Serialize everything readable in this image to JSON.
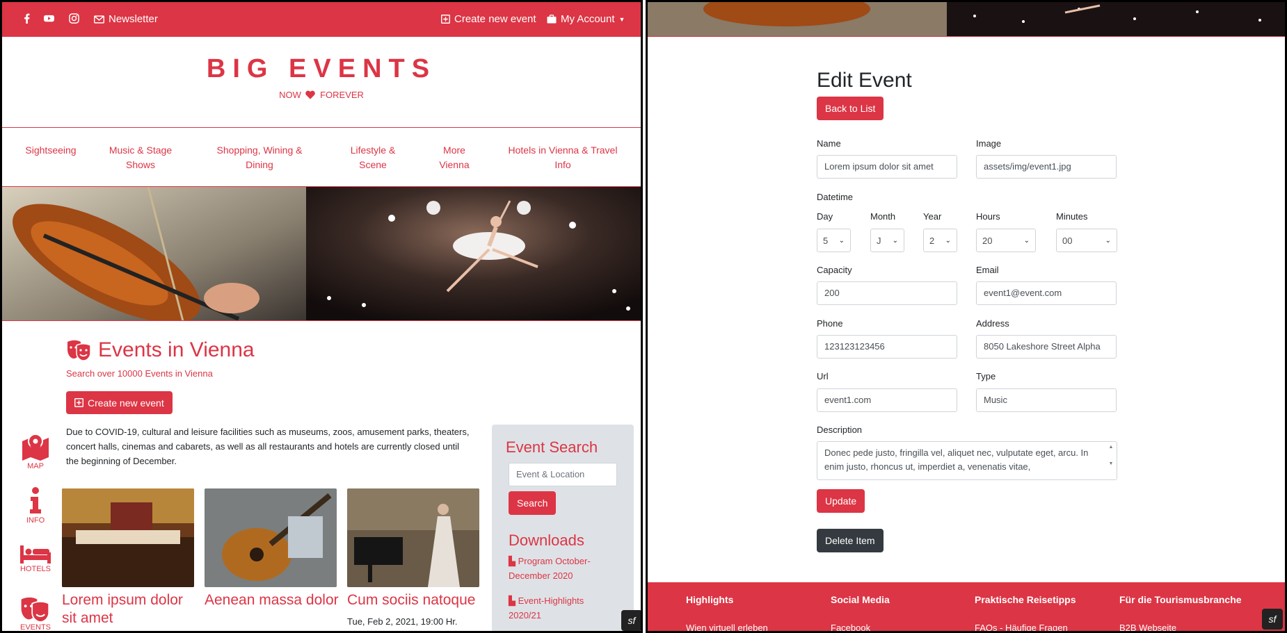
{
  "left": {
    "topbar": {
      "newsletter": "Newsletter",
      "create_event": "Create new event",
      "my_account": "My Account"
    },
    "brand": {
      "title": "BIG EVENTS",
      "tagline_left": "NOW",
      "tagline_right": "FOREVER"
    },
    "nav": [
      {
        "label": "Sightseeing"
      },
      {
        "label": "Music & Stage Shows"
      },
      {
        "label": "Shopping, Wining & Dining"
      },
      {
        "label": "Lifestyle & Scene"
      },
      {
        "label": "More Vienna"
      },
      {
        "label": "Hotels in Vienna & Travel Info"
      }
    ],
    "main": {
      "title": "Events in Vienna",
      "subtitle": "Search over 10000 Events in Vienna",
      "create_button": "Create new event",
      "covid_notice": "Due to COVID-19, cultural and leisure facilities such as museums, zoos, amusement parks, theaters, concert halls, cinemas and cabarets, as well as all restaurants and hotels are currently closed until the beginning of December."
    },
    "side_nav": [
      {
        "label": "MAP",
        "icon": "map-marker-icon"
      },
      {
        "label": "INFO",
        "icon": "info-icon"
      },
      {
        "label": "HOTELS",
        "icon": "bed-icon"
      },
      {
        "label": "EVENTS",
        "icon": "theater-masks-icon"
      }
    ],
    "cards": [
      {
        "title": "Lorem ipsum dolor sit amet",
        "date": ""
      },
      {
        "title": "Aenean massa dolor",
        "date": ""
      },
      {
        "title": "Cum sociis natoque",
        "date": "Tue, Feb 2, 2021, 19:00 Hr."
      }
    ],
    "search": {
      "title": "Event Search",
      "placeholder": "Event & Location",
      "button": "Search",
      "downloads_title": "Downloads",
      "downloads": [
        "Program October-December 2020",
        "Event-Highlights 2020/21"
      ]
    }
  },
  "right": {
    "title": "Edit Event",
    "back_button": "Back to List",
    "labels": {
      "name": "Name",
      "image": "Image",
      "datetime": "Datetime",
      "day": "Day",
      "month": "Month",
      "year": "Year",
      "hours": "Hours",
      "minutes": "Minutes",
      "capacity": "Capacity",
      "email": "Email",
      "phone": "Phone",
      "address": "Address",
      "url": "Url",
      "type": "Type",
      "description": "Description"
    },
    "values": {
      "name": "Lorem ipsum dolor sit amet",
      "image": "assets/img/event1.jpg",
      "day": "5",
      "month": "J",
      "year": "2",
      "hours": "20",
      "minutes": "00",
      "capacity": "200",
      "email": "event1@event.com",
      "phone": "123123123456",
      "address": "8050 Lakeshore Street Alpha",
      "url": "event1.com",
      "type": "Music",
      "description": "Donec pede justo, fringilla vel, aliquet nec, vulputate eget, arcu. In enim justo, rhoncus ut, imperdiet a, venenatis vitae,"
    },
    "update_button": "Update",
    "delete_button": "Delete Item",
    "footer": {
      "headings": [
        "Highlights",
        "Social Media",
        "Praktische Reisetipps",
        "Für die Tourismusbranche"
      ],
      "links": [
        "Wien virtuell erleben",
        "Facebook",
        "FAQs - Häufige Fragen",
        "B2B Webseite"
      ]
    }
  },
  "colors": {
    "accent": "#dc3545",
    "dark_button": "#343a40",
    "sidebar_bg": "#dee2e6"
  }
}
